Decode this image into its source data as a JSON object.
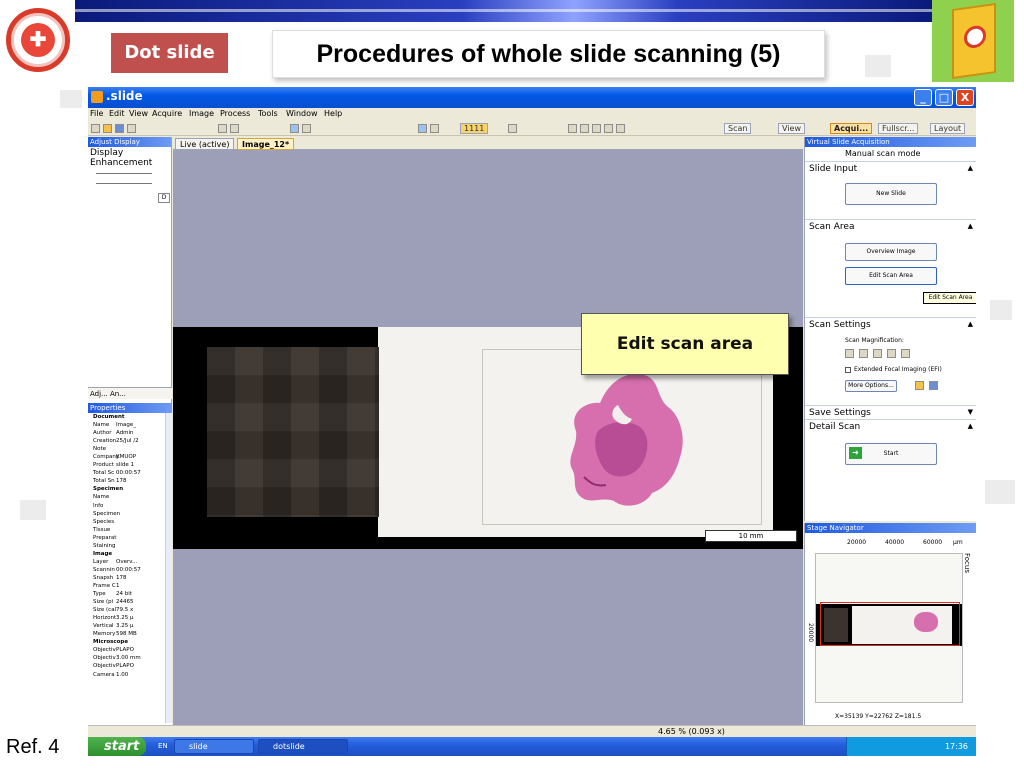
{
  "slide": {
    "tag": "Dot slide",
    "title": "Procedures of whole slide scanning (5)",
    "ref": "Ref. 4",
    "callout": "Edit scan area"
  },
  "app": {
    "title": ".slide",
    "menu": [
      "File",
      "Edit",
      "View",
      "Acquire",
      "Image",
      "Process",
      "Tools",
      "Window",
      "Help"
    ],
    "toolbar_counter": "1111",
    "toolbar_tabs": [
      "Scan",
      "View",
      "Acqui...",
      "Fullscr..."
    ],
    "layout_btn": "Layout",
    "win_controls": [
      "_",
      "□",
      "X"
    ]
  },
  "left": {
    "panel_title": "Adjust Display",
    "display_label": "Display Enhancement",
    "panel_button": "D",
    "tabs": "Adj... An...",
    "props_title": "Properties",
    "rows": [
      {
        "k": "Document",
        "v": "",
        "sec": true
      },
      {
        "k": "Name",
        "v": "Image_"
      },
      {
        "k": "Author",
        "v": "Admin"
      },
      {
        "k": "Creation",
        "v": "25/Jul /2"
      },
      {
        "k": "Note",
        "v": ""
      },
      {
        "k": "Company",
        "v": "KMUOP"
      },
      {
        "k": "Product",
        "v": "slide 1"
      },
      {
        "k": "Total Sc",
        "v": "00:00:57"
      },
      {
        "k": "Total Sn",
        "v": "178"
      },
      {
        "k": "Specimen",
        "v": "",
        "sec": true
      },
      {
        "k": "Name",
        "v": ""
      },
      {
        "k": "Info",
        "v": ""
      },
      {
        "k": "Specimen",
        "v": ""
      },
      {
        "k": "Species",
        "v": ""
      },
      {
        "k": "Tissue",
        "v": ""
      },
      {
        "k": "Preparat",
        "v": ""
      },
      {
        "k": "Staining",
        "v": ""
      },
      {
        "k": "Image",
        "v": "",
        "sec": true
      },
      {
        "k": "Layer",
        "v": "Overv..."
      },
      {
        "k": "Scannin",
        "v": "00:00:57"
      },
      {
        "k": "Snapsh",
        "v": "178"
      },
      {
        "k": "Frame C",
        "v": "1"
      },
      {
        "k": "Type",
        "v": "24 bit"
      },
      {
        "k": "Size (pi",
        "v": "24465"
      },
      {
        "k": "Size (cal",
        "v": "79.5 x"
      },
      {
        "k": "Horizont",
        "v": "3.25 µ"
      },
      {
        "k": "Vertical",
        "v": "3.25 µ"
      },
      {
        "k": "Memory",
        "v": "598 MB"
      },
      {
        "k": "Microscope",
        "v": "",
        "sec": true
      },
      {
        "k": "Objectiv",
        "v": "PLAPO"
      },
      {
        "k": "Objectiv",
        "v": "3.00 mm"
      },
      {
        "k": "Objectiv",
        "v": "PLAPO"
      },
      {
        "k": "Camera",
        "v": "1.00"
      }
    ]
  },
  "viewer": {
    "tab_live": "Live (active)",
    "tab_image": "Image_12*",
    "scale": "10 mm"
  },
  "right": {
    "panel_title": "Virtual Slide Acquisition",
    "mode": "Manual scan mode",
    "slide_input": "Slide Input",
    "new_slide": "New Slide",
    "scan_area": "Scan Area",
    "overview": "Overview Image",
    "edit_scan": "Edit Scan Area",
    "tooltip": "Edit Scan Area",
    "scan_settings": "Scan Settings",
    "scan_mag": "Scan Magnification:",
    "efi": "Extended Focal Imaging (EFI)",
    "more": "More Options...",
    "save_settings": "Save Settings",
    "detail_scan": "Detail Scan",
    "start": "Start",
    "nav_title": "Stage Navigator",
    "nav_ticks": [
      "20000",
      "40000",
      "60000",
      "µm"
    ],
    "nav_y": "20000",
    "focus": "Focus",
    "coords": "X=35139  Y=22762  Z=181.5"
  },
  "status": {
    "zoom": "4.65 % (0.093 x)"
  },
  "taskbar": {
    "start": "start",
    "lang": "EN",
    "item1": "slide",
    "item2": "dotslide",
    "clock": "17:36"
  }
}
